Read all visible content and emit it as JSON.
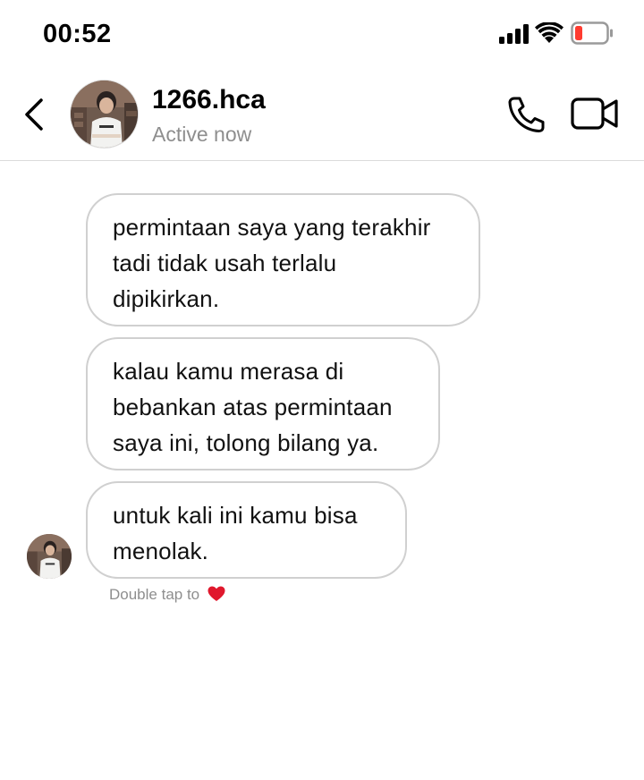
{
  "status_bar": {
    "time": "00:52"
  },
  "header": {
    "contact_name": "1266.hca",
    "contact_status": "Active now",
    "icons": [
      "chevron-left-icon",
      "phone-icon",
      "video-camera-icon"
    ]
  },
  "messages": [
    {
      "lines": [
        "permintaan saya yang terakhir",
        "tadi tidak usah terlalu",
        "dipikirkan."
      ]
    },
    {
      "lines": [
        "kalau kamu merasa di",
        "bebankan atas permintaan",
        "saya ini, tolong bilang ya."
      ]
    },
    {
      "lines": [
        "untuk kali ini kamu bisa",
        "menolak."
      ]
    }
  ],
  "hint": {
    "text": "Double tap to",
    "icon": "heart-icon"
  },
  "colors": {
    "bubble_border": "#d0d0d0",
    "secondary_text": "#8e8e8e",
    "battery_low": "#ff3b30",
    "heart": "#e0182d"
  }
}
